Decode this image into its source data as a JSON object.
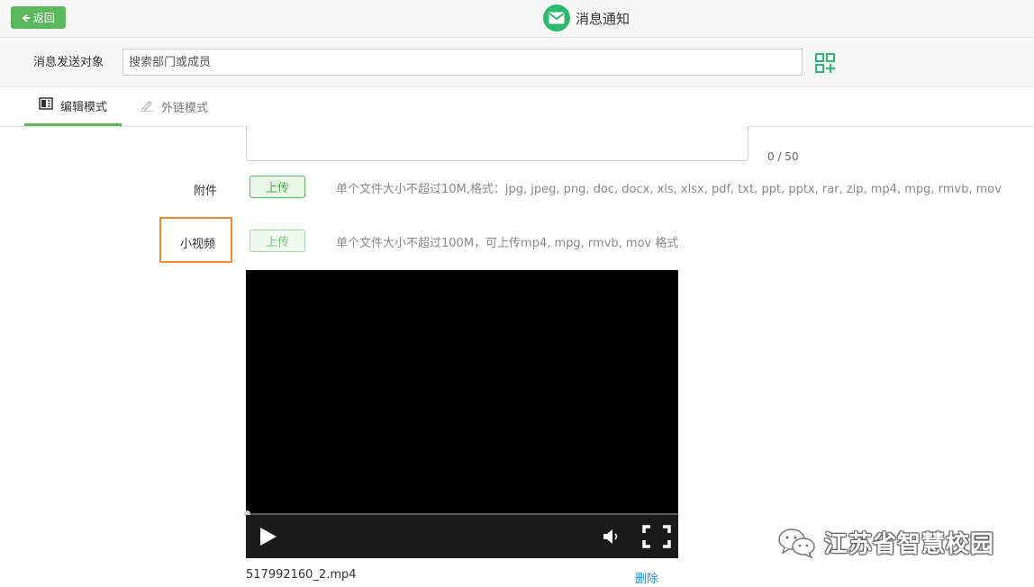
{
  "header": {
    "back_label": "返回",
    "title": "消息通知",
    "icon": "mail-icon",
    "accent_color": "#5cb85c"
  },
  "recipients": {
    "label": "消息发送对象",
    "placeholder": "搜索部门或成员",
    "value": "",
    "add_icon": "qr-add-icon"
  },
  "tabs": [
    {
      "label": "编辑模式",
      "icon": "book-icon",
      "active": true
    },
    {
      "label": "外链模式",
      "icon": "pencil-icon",
      "active": false
    }
  ],
  "content": {
    "char_count": "0 / 50",
    "attachment": {
      "label": "附件",
      "button": "上传",
      "hint": "单个文件大小不超过10M,格式：jpg, jpeg, png, doc, docx, xls, xlsx, pdf, txt, ppt, pptx, rar, zip, mp4, mpg, rmvb, mov"
    },
    "video": {
      "label": "小视频",
      "button": "上传",
      "hint": "单个文件大小不超过100M，可上传mp4, mpg, rmvb, mov 格式",
      "highlight_color": "#ef8c33",
      "file_name": "517992160_2.mp4",
      "delete_label": "删除",
      "progress": 0
    }
  },
  "watermark": {
    "text": "江苏省智慧校园",
    "icon": "wechat-icon"
  }
}
